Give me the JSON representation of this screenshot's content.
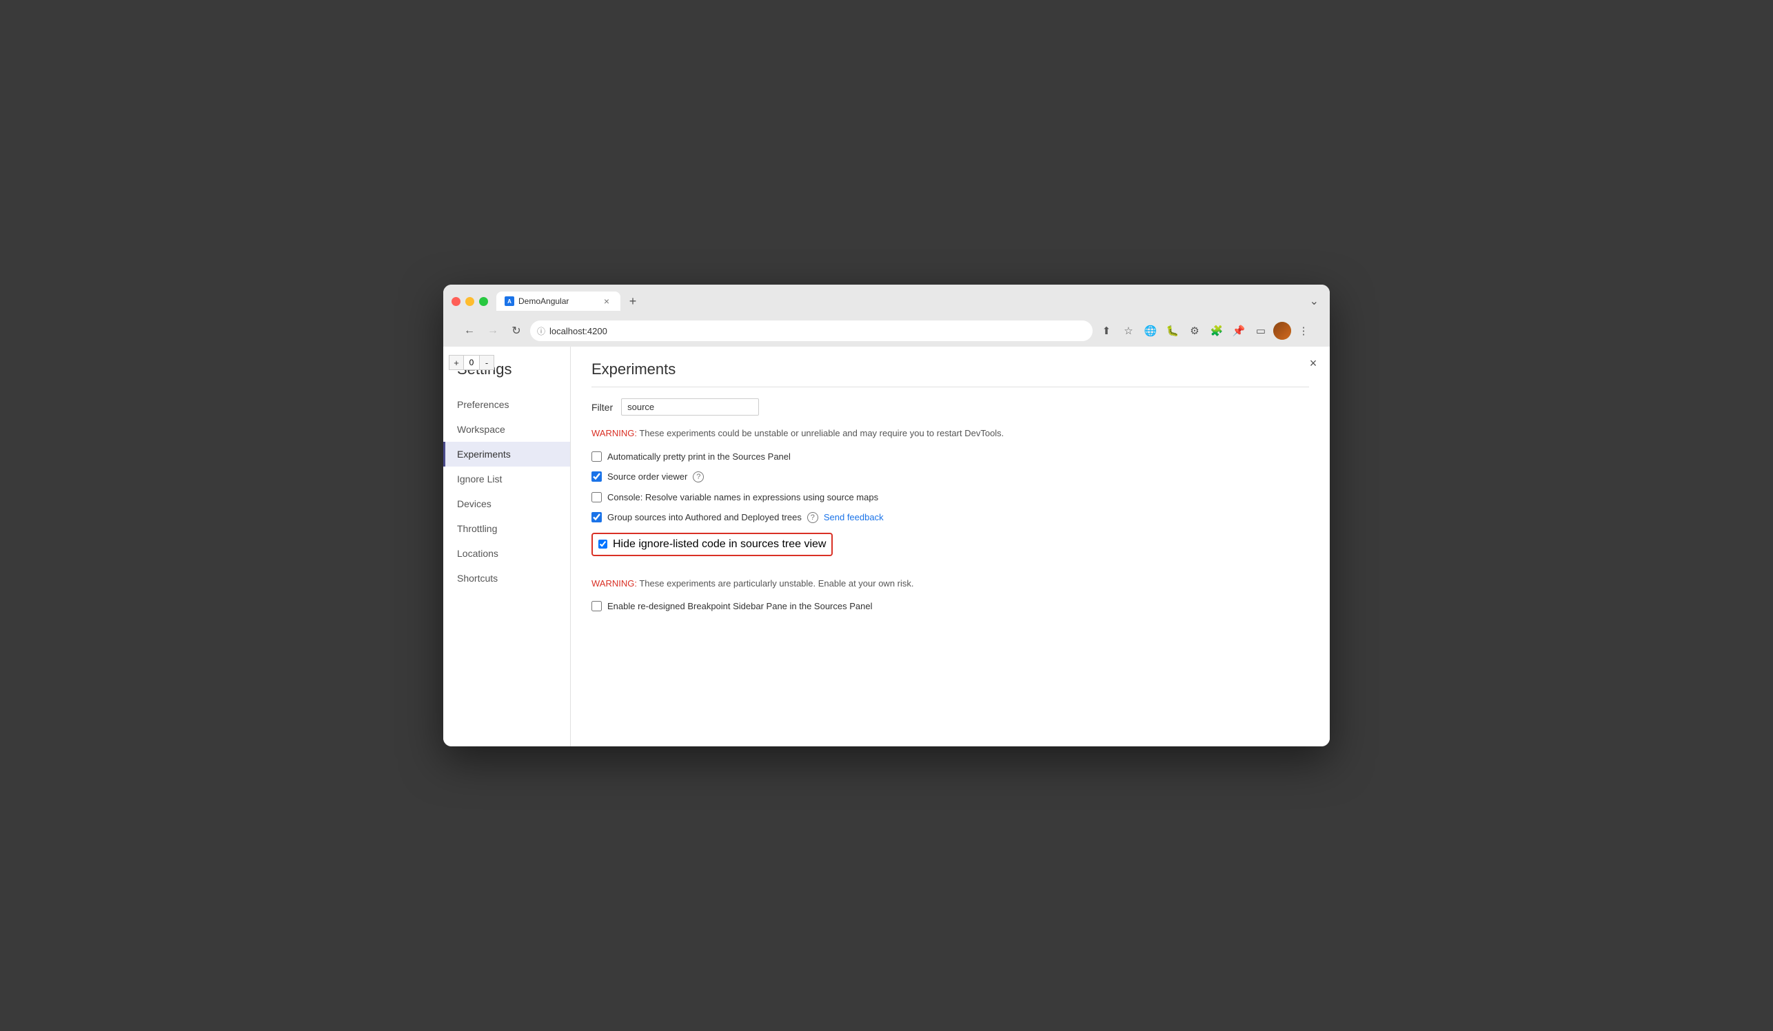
{
  "browser": {
    "tab_title": "DemoAngular",
    "tab_favicon": "A",
    "url": "localhost:4200",
    "chevron_down": "⌄",
    "tab_close": "×",
    "tab_add": "+",
    "back_arrow": "←",
    "forward_arrow": "→",
    "reload": "↻",
    "info_icon": "ⓘ"
  },
  "counter": {
    "plus": "+",
    "value": "0",
    "minus": "-"
  },
  "settings": {
    "title": "Settings",
    "close_icon": "×",
    "nav_items": [
      {
        "id": "preferences",
        "label": "Preferences",
        "active": false
      },
      {
        "id": "workspace",
        "label": "Workspace",
        "active": false
      },
      {
        "id": "experiments",
        "label": "Experiments",
        "active": true
      },
      {
        "id": "ignore-list",
        "label": "Ignore List",
        "active": false
      },
      {
        "id": "devices",
        "label": "Devices",
        "active": false
      },
      {
        "id": "throttling",
        "label": "Throttling",
        "active": false
      },
      {
        "id": "locations",
        "label": "Locations",
        "active": false
      },
      {
        "id": "shortcuts",
        "label": "Shortcuts",
        "active": false
      }
    ]
  },
  "experiments": {
    "section_title": "Experiments",
    "filter_label": "Filter",
    "filter_value": "source",
    "filter_placeholder": "Filter",
    "warning1": "WARNING:",
    "warning1_text": " These experiments could be unstable or unreliable and may require you to restart DevTools.",
    "items": [
      {
        "id": "pretty-print",
        "label": "Automatically pretty print in the Sources Panel",
        "checked": false,
        "highlighted": false,
        "has_help": false,
        "has_feedback": false
      },
      {
        "id": "source-order",
        "label": "Source order viewer",
        "checked": true,
        "highlighted": false,
        "has_help": true,
        "has_feedback": false
      },
      {
        "id": "resolve-vars",
        "label": "Console: Resolve variable names in expressions using source maps",
        "checked": false,
        "highlighted": false,
        "has_help": false,
        "has_feedback": false
      },
      {
        "id": "group-sources",
        "label": "Group sources into Authored and Deployed trees",
        "checked": true,
        "highlighted": false,
        "has_help": true,
        "has_feedback": true,
        "feedback_text": "Send feedback"
      },
      {
        "id": "hide-ignore",
        "label": "Hide ignore-listed code in sources tree view",
        "checked": true,
        "highlighted": true,
        "has_help": false,
        "has_feedback": false
      }
    ],
    "warning2": "WARNING:",
    "warning2_text": " These experiments are particularly unstable. Enable at your own risk.",
    "unstable_items": [
      {
        "id": "breakpoint-sidebar",
        "label": "Enable re-designed Breakpoint Sidebar Pane in the Sources Panel",
        "checked": false
      }
    ]
  }
}
